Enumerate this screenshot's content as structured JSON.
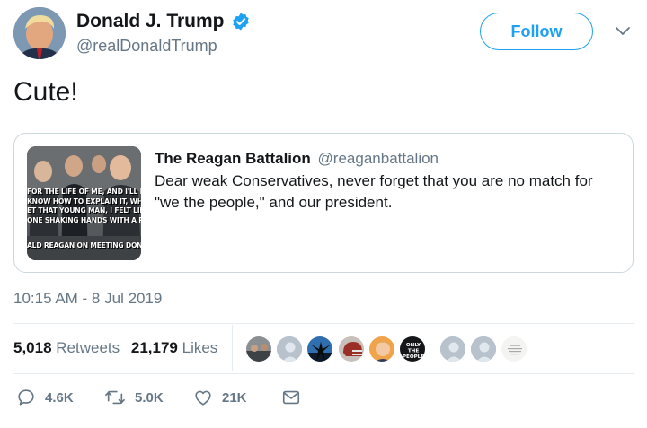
{
  "author": {
    "display_name": "Donald J. Trump",
    "handle": "@realDonaldTrump",
    "verified": true,
    "avatar_icon": "profile-photo"
  },
  "follow_button": {
    "label": "Follow"
  },
  "menu_icon": "chevron-down-icon",
  "tweet": {
    "text": "Cute!"
  },
  "quoted_tweet": {
    "author_name": "The Reagan Battalion",
    "author_handle": "@reaganbattalion",
    "text": "Dear weak Conservatives, never forget that you are no match for \"we the people,\" and our president.",
    "media_caption_lines": [
      "FOR THE LIFE OF ME, AND I'LL NEVER",
      "KNOW HOW TO EXPLAIN IT, WHEN I",
      "ET THAT YOUNG MAN, I FELT LIKE I W",
      "ONE SHAKING HANDS WITH A PRESI"
    ],
    "media_caption_footer": "ALD REAGAN ON MEETING DONALD T"
  },
  "timestamp": "10:15 AM - 8 Jul 2019",
  "stats": {
    "retweets_count": "5,018",
    "retweets_label": "Retweets",
    "likes_count": "21,179",
    "likes_label": "Likes"
  },
  "likers": [
    {
      "icon": "group-photo-avatar"
    },
    {
      "icon": "default-avatar"
    },
    {
      "icon": "silhouette-avatar"
    },
    {
      "icon": "football-helmet-avatar"
    },
    {
      "icon": "person-photo-avatar"
    },
    {
      "icon": "text-logo-avatar",
      "text": "ONLY THE PEOPLE"
    },
    {
      "icon": "default-avatar"
    },
    {
      "icon": "default-avatar"
    },
    {
      "icon": "text-note-avatar"
    }
  ],
  "actions": {
    "reply_count": "4.6K",
    "retweet_count": "5.0K",
    "like_count": "21K",
    "reply_icon": "reply-icon",
    "retweet_icon": "retweet-icon",
    "like_icon": "heart-icon",
    "dm_icon": "envelope-icon"
  },
  "colors": {
    "accent": "#1da1f2",
    "secondary_text": "#657786",
    "border": "#ccd6dd"
  }
}
